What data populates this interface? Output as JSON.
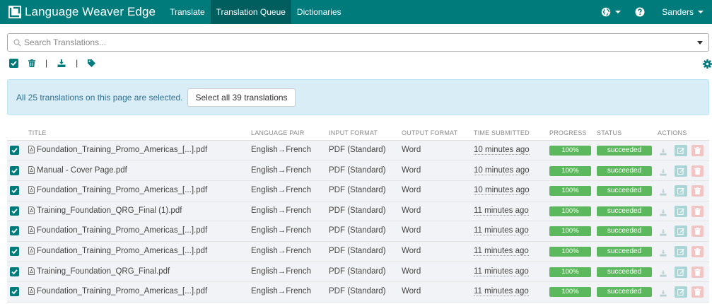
{
  "nav": {
    "brand": "Language Weaver Edge",
    "items": [
      "Translate",
      "Translation Queue",
      "Dictionaries"
    ],
    "active": "Translation Queue",
    "user": "Sanders",
    "icons": [
      "globe-icon",
      "help-icon"
    ]
  },
  "search": {
    "placeholder": "Search Translations...",
    "value": ""
  },
  "toolbar": {
    "icons": [
      "select-all-checkbox",
      "trash-icon",
      "download-icon",
      "tag-icon"
    ],
    "settings_icon": "gear-icon"
  },
  "alert": {
    "text": "All 25 translations on this page are selected.",
    "button": "Select all 39 translations"
  },
  "table": {
    "headers": {
      "title": "Title",
      "language_pair": "Language Pair",
      "input_format": "Input Format",
      "output_format": "Output Format",
      "time_submitted": "Time Submitted",
      "progress": "Progress",
      "status": "Status",
      "actions": "Actions"
    },
    "rows": [
      {
        "title": "Foundation_Training_Promo_Americas_[...].pdf",
        "pair": "English→French",
        "input": "PDF (Standard)",
        "output": "Word",
        "time": "10 minutes ago",
        "progress": "100%",
        "status": "succeeded"
      },
      {
        "title": "Manual - Cover Page.pdf",
        "pair": "English→French",
        "input": "PDF (Standard)",
        "output": "Word",
        "time": "10 minutes ago",
        "progress": "100%",
        "status": "succeeded"
      },
      {
        "title": "Foundation_Training_Promo_Americas_[...].pdf",
        "pair": "English→French",
        "input": "PDF (Standard)",
        "output": "Word",
        "time": "10 minutes ago",
        "progress": "100%",
        "status": "succeeded"
      },
      {
        "title": "Training_Foundation_QRG_Final (1).pdf",
        "pair": "English→French",
        "input": "PDF (Standard)",
        "output": "Word",
        "time": "11 minutes ago",
        "progress": "100%",
        "status": "succeeded"
      },
      {
        "title": "Foundation_Training_Promo_Americas_[...].pdf",
        "pair": "English→French",
        "input": "PDF (Standard)",
        "output": "Word",
        "time": "11 minutes ago",
        "progress": "100%",
        "status": "succeeded"
      },
      {
        "title": "Foundation_Training_Promo_Americas_[...].pdf",
        "pair": "English→French",
        "input": "PDF (Standard)",
        "output": "Word",
        "time": "11 minutes ago",
        "progress": "100%",
        "status": "succeeded"
      },
      {
        "title": "Training_Foundation_QRG_Final.pdf",
        "pair": "English→French",
        "input": "PDF (Standard)",
        "output": "Word",
        "time": "11 minutes ago",
        "progress": "100%",
        "status": "succeeded"
      },
      {
        "title": "Foundation_Training_Promo_Americas_[...].pdf",
        "pair": "English→French",
        "input": "PDF (Standard)",
        "output": "Word",
        "time": "11 minutes ago",
        "progress": "100%",
        "status": "succeeded"
      }
    ]
  },
  "colors": {
    "brand": "#007b7c",
    "nav_active": "#005e5f",
    "success": "#5cb85c",
    "alert_bg": "#d9edf7"
  }
}
